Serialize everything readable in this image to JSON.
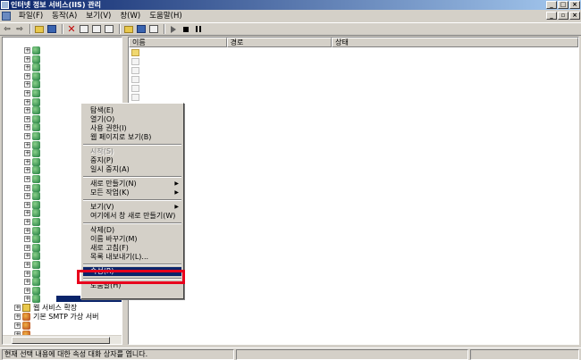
{
  "window": {
    "title": "인터넷 정보 서비스(IIS) 관리",
    "controls": [
      "_",
      "□",
      "×"
    ]
  },
  "menubar": {
    "items": [
      "파일(F)",
      "동작(A)",
      "보기(V)",
      "창(W)",
      "도움말(H)"
    ],
    "doc_controls": [
      "_",
      "▫",
      "×"
    ]
  },
  "toolbar": {
    "back": "⇦",
    "forward": "⇨"
  },
  "list": {
    "columns": [
      "이름",
      "경로",
      "상태"
    ]
  },
  "tree": {
    "extra_items": [
      {
        "label": "웹 서비스 확장"
      },
      {
        "label": "기본 SMTP 가상 서버"
      },
      {
        "label": ""
      },
      {
        "label": ""
      }
    ]
  },
  "context_menu": {
    "items": [
      {
        "label": "탐색(E)",
        "type": "item"
      },
      {
        "label": "열기(O)",
        "type": "item"
      },
      {
        "label": "사용 권한(I)",
        "type": "item"
      },
      {
        "label": "웹 페이지로 보기(B)",
        "type": "item"
      },
      {
        "type": "sep"
      },
      {
        "label": "시작(S)",
        "type": "disabled"
      },
      {
        "label": "중지(P)",
        "type": "item"
      },
      {
        "label": "일시 중지(A)",
        "type": "item"
      },
      {
        "type": "sep"
      },
      {
        "label": "새로 만들기(N)",
        "type": "submenu"
      },
      {
        "label": "모든 작업(K)",
        "type": "submenu"
      },
      {
        "type": "sep"
      },
      {
        "label": "보기(V)",
        "type": "submenu"
      },
      {
        "label": "여기에서 창 새로 만들기(W)",
        "type": "item"
      },
      {
        "type": "sep"
      },
      {
        "label": "삭제(D)",
        "type": "item"
      },
      {
        "label": "이름 바꾸기(M)",
        "type": "item"
      },
      {
        "label": "새로 고침(F)",
        "type": "item"
      },
      {
        "label": "목록 내보내기(L)...",
        "type": "item"
      },
      {
        "type": "sep"
      },
      {
        "label": "속성(R)",
        "type": "highlight"
      },
      {
        "type": "sep"
      },
      {
        "label": "도움말(H)",
        "type": "item"
      }
    ]
  },
  "statusbar": {
    "text": "현재 선택 내용에 대한 속성 대화 상자를 엽니다."
  }
}
